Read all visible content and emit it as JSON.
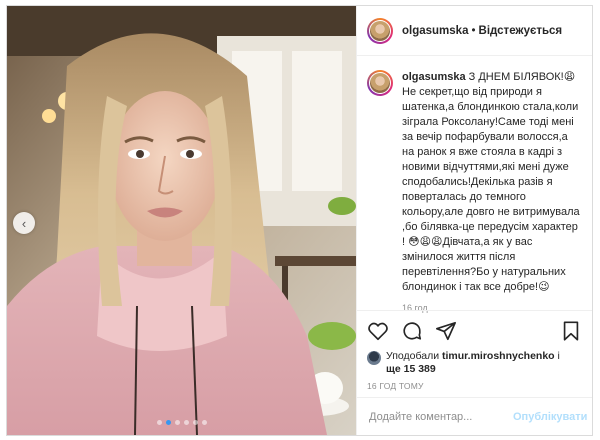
{
  "post": {
    "username": "olgasumska",
    "separator": "•",
    "follow_state": "Відстежується",
    "caption_username": "olgasumska",
    "caption_text": " З ДНЕМ БІЛЯВОК!😩Не секрет,що від природи я шатенка,а блондинкою стала,коли зіграла Роксолану!Саме тоді мені за вечір пофарбували волосся,а на ранок я вже стояла в кадрі з новими відчуттями,які мені дуже сподобались!Декілька разів я поверталась до темного кольору,але довго не витримувала ,бо білявка-це передусім характер ! 😳😩😩Дівчата,а як у вас змінилося життя після перевтілення?Бо у натуральних блондинок і так все добре!😉",
    "caption_time": "16 год.",
    "likes_prefix": "Уподобали ",
    "likes_user": "timur.miroshnychenko",
    "likes_and": " і ",
    "likes_more": "ще 15 389",
    "date": "16 ГОД ТОМУ",
    "comment_placeholder": "Додайте коментар...",
    "publish_label": "Опублікувати"
  },
  "carousel": {
    "prev_arrow": "‹",
    "dot_count": 6,
    "active_dot": 1
  },
  "icons": {
    "like": "heart-icon",
    "comment": "comment-icon",
    "share": "share-icon",
    "save": "bookmark-icon",
    "prev": "chevron-left-icon"
  },
  "colors": {
    "link_blue": "#3897f0",
    "publish_disabled": "#b2dffc",
    "muted": "#8e8e8e",
    "text": "#262626"
  }
}
